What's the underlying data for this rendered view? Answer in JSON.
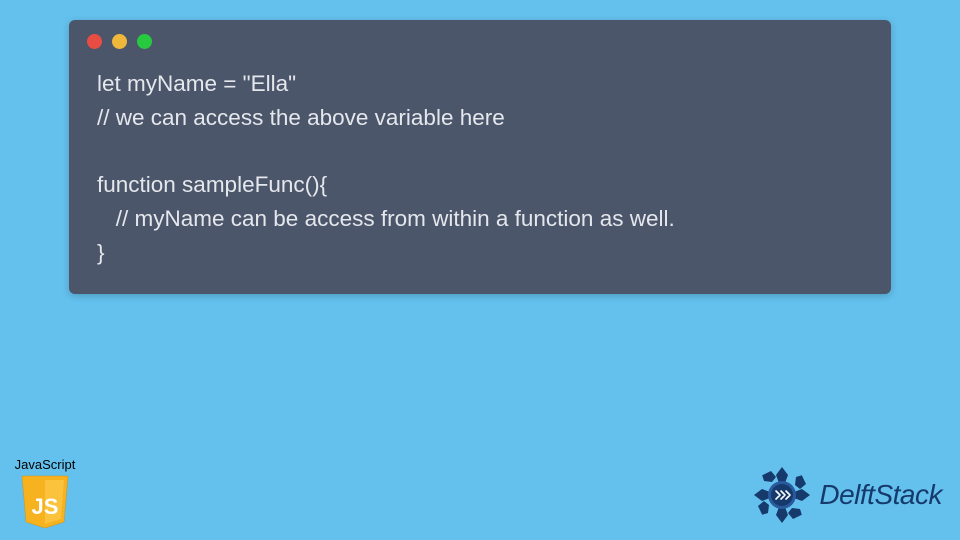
{
  "code": {
    "lines": [
      "let myName = \"Ella\"",
      "// we can access the above variable here",
      "",
      "function sampleFunc(){",
      "   // myName can be access from within a function as well.",
      "}"
    ]
  },
  "js_badge": {
    "label": "JavaScript",
    "logo_text": "JS"
  },
  "brand": {
    "name": "DelftStack"
  },
  "colors": {
    "bg": "#64c1ee",
    "window": "#4c566a",
    "code_text": "#e4e7ec",
    "js_yellow": "#f7b21f",
    "delft_blue": "#153a6b"
  }
}
